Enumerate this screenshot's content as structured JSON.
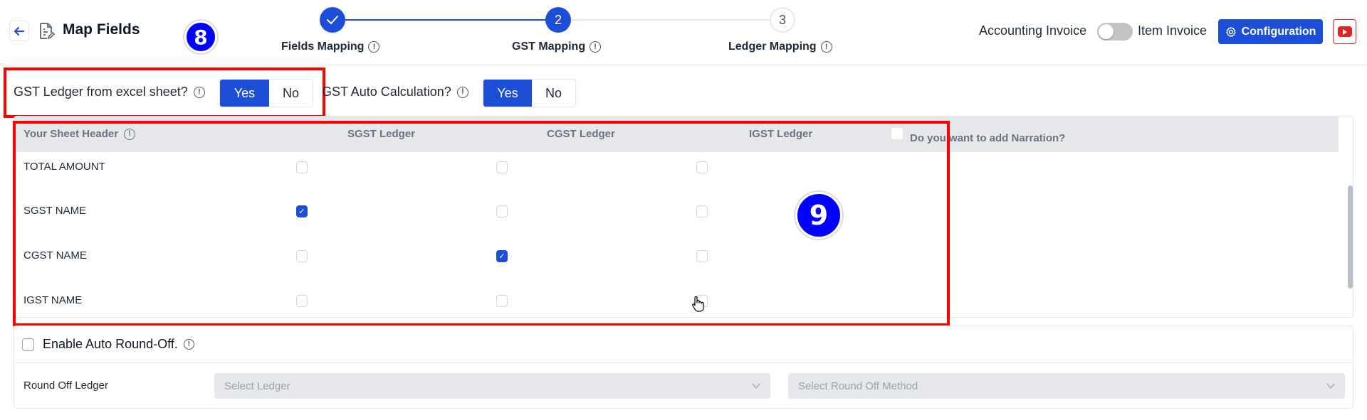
{
  "header": {
    "title": "Map Fields",
    "annotation_badge": "8",
    "accounting_invoice_label": "Accounting Invoice",
    "item_invoice_label": "Item Invoice",
    "invoice_toggle_on": false,
    "configuration_label": "Configuration",
    "accent_color": "#1d4ed8"
  },
  "stepper": {
    "steps": [
      {
        "number": "1",
        "label": "Fields Mapping",
        "state": "completed"
      },
      {
        "number": "2",
        "label": "GST Mapping",
        "state": "active"
      },
      {
        "number": "3",
        "label": "Ledger Mapping",
        "state": "pending"
      }
    ]
  },
  "gst_options": {
    "ledger_from_excel": {
      "label": "GST Ledger from excel sheet?",
      "yes": "Yes",
      "no": "No",
      "selected": "Yes"
    },
    "auto_calculation": {
      "label": "GST Auto Calculation?",
      "yes": "Yes",
      "no": "No",
      "selected": "Yes"
    }
  },
  "mapping_table": {
    "annotation_badge": "9",
    "columns": [
      "Your Sheet Header",
      "SGST Ledger",
      "CGST Ledger",
      "IGST Ledger"
    ],
    "narration_label": "Do you want to add Narration?",
    "narration_checked": false,
    "rows": [
      {
        "header": "TOTAL AMOUNT",
        "sgst": false,
        "cgst": false,
        "igst": false
      },
      {
        "header": "SGST NAME",
        "sgst": true,
        "cgst": false,
        "igst": false
      },
      {
        "header": "CGST NAME",
        "sgst": false,
        "cgst": true,
        "igst": false
      },
      {
        "header": "IGST NAME",
        "sgst": false,
        "cgst": false,
        "igst": false
      }
    ]
  },
  "round_off": {
    "enable_label": "Enable Auto Round-Off.",
    "enabled": false,
    "ledger_label": "Round Off Ledger",
    "ledger_placeholder": "Select Ledger",
    "method_placeholder": "Select Round Off Method"
  }
}
